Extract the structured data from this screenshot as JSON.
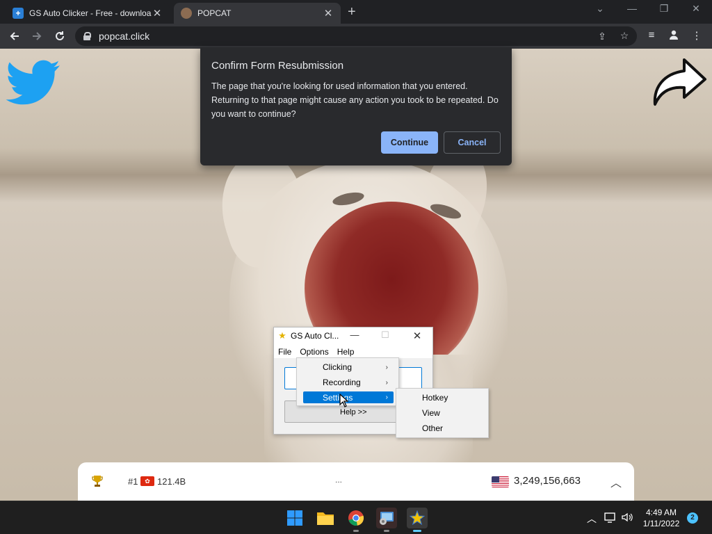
{
  "browser": {
    "tabs": [
      {
        "title": "GS Auto Clicker - Free - downloa",
        "close": "✕"
      },
      {
        "title": "POPCAT",
        "close": "✕"
      }
    ],
    "new_tab": "+",
    "window_controls": {
      "minimize": "—",
      "maximize": "❐",
      "close": "✕",
      "tabsearch": "⌄"
    },
    "url": "popcat.click"
  },
  "dialog": {
    "title": "Confirm Form Resubmission",
    "message": "The page that you're looking for used information that you entered. Returning to that page might cause any action you took to be repeated. Do you want to continue?",
    "continue_label": "Continue",
    "cancel_label": "Cancel"
  },
  "gs_window": {
    "title": "GS Auto Cl...",
    "menus": [
      "File",
      "Options",
      "Help"
    ],
    "help_link": "Help >>",
    "options_menu": [
      {
        "label": "Clicking",
        "arrow": "›"
      },
      {
        "label": "Recording",
        "arrow": "›"
      },
      {
        "label": "Settings",
        "arrow": "›"
      }
    ],
    "settings_submenu": [
      "Hotkey",
      "View",
      "Other"
    ]
  },
  "leaderboard": {
    "rank": "#1",
    "hk_value": "121.4B",
    "more": "...",
    "us_value": "3,249,156,663"
  },
  "taskbar": {
    "time": "4:49 AM",
    "date": "1/11/2022",
    "notifications": "2"
  },
  "colors": {
    "accent": "#8ab4f8",
    "selection": "#0078d7",
    "twitter": "#1da1f2"
  }
}
